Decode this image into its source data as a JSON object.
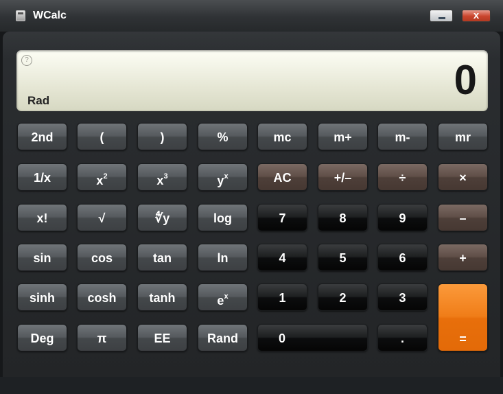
{
  "window": {
    "title": "WCalc",
    "minimize_label": "–",
    "close_label": "x"
  },
  "display": {
    "help": "?",
    "value": "0",
    "mode": "Rad"
  },
  "keys": {
    "r1": [
      "2nd",
      "(",
      ")",
      "%",
      "mc",
      "m+",
      "m-",
      "mr"
    ],
    "r2": [
      "1/x",
      "x",
      "x",
      "y",
      "AC",
      "+/–",
      "÷",
      "×"
    ],
    "r2_sup": {
      "x2": "2",
      "x3": "3",
      "yx": "x"
    },
    "r3": [
      "x!",
      "√",
      "∜y",
      "log",
      "7",
      "8",
      "9",
      "–"
    ],
    "r4": [
      "sin",
      "cos",
      "tan",
      "ln",
      "4",
      "5",
      "6",
      "+"
    ],
    "r5": [
      "sinh",
      "cosh",
      "tanh",
      "e",
      "1",
      "2",
      "3"
    ],
    "r5_sup": {
      "ex": "x"
    },
    "r6": [
      "Deg",
      "π",
      "EE",
      "Rand",
      "0",
      "."
    ],
    "equals": "="
  },
  "colors": {
    "accent": "#f07d18",
    "operator": "#5f4e47",
    "function": "#55595d",
    "digit": "#1d1f20"
  }
}
